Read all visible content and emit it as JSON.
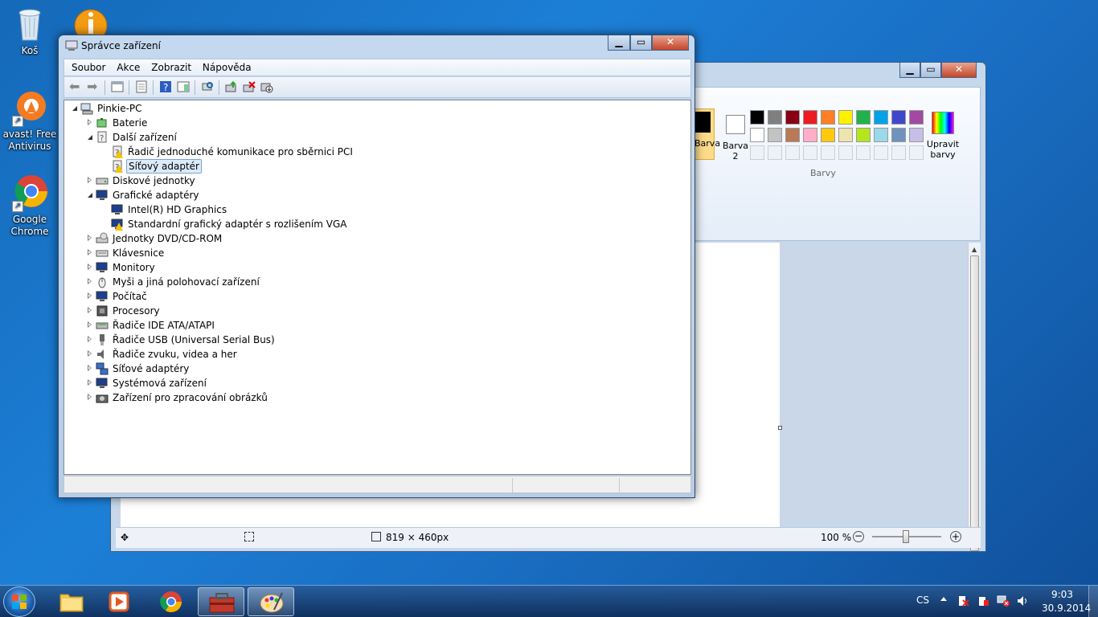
{
  "desktop": {
    "icons": [
      {
        "label": "Koš"
      },
      {
        "label": "avast! Free Antivirus"
      },
      {
        "label": "Google Chrome"
      }
    ]
  },
  "paint": {
    "ribbon": {
      "color1_label": "Barva",
      "color2_label": "Barva 2",
      "colors_group_label": "Barvy",
      "edit_colors_label": "Upravit barvy",
      "palette_row1": [
        "#000000",
        "#7f7f7f",
        "#880015",
        "#ed1c24",
        "#ff7f27",
        "#fff200",
        "#22b14c",
        "#00a2e8",
        "#3f48cc",
        "#a349a4"
      ],
      "palette_row2": [
        "#ffffff",
        "#c3c3c3",
        "#b97a57",
        "#ffaec9",
        "#ffc90e",
        "#efe4b0",
        "#b5e61d",
        "#99d9ea",
        "#7092be",
        "#c8bfe7"
      ]
    },
    "status": {
      "size": "819 × 460px",
      "zoom": "100 %"
    }
  },
  "devmgr": {
    "title": "Správce zařízení",
    "menu": [
      "Soubor",
      "Akce",
      "Zobrazit",
      "Nápověda"
    ],
    "tree": {
      "root": "Pinkie-PC",
      "nodes": [
        {
          "label": "Baterie"
        },
        {
          "label": "Další zařízení"
        },
        {
          "label": "Řadič jednoduché komunikace pro sběrnici PCI"
        },
        {
          "label": "Síťový adaptér"
        },
        {
          "label": "Diskové jednotky"
        },
        {
          "label": "Grafické adaptéry"
        },
        {
          "label": "Intel(R) HD Graphics"
        },
        {
          "label": "Standardní grafický adaptér s rozlišením VGA"
        },
        {
          "label": "Jednotky DVD/CD-ROM"
        },
        {
          "label": "Klávesnice"
        },
        {
          "label": "Monitory"
        },
        {
          "label": "Myši a jiná polohovací zařízení"
        },
        {
          "label": "Počítač"
        },
        {
          "label": "Procesory"
        },
        {
          "label": "Řadiče IDE ATA/ATAPI"
        },
        {
          "label": "Řadiče USB (Universal Serial Bus)"
        },
        {
          "label": "Řadiče zvuku, videa a her"
        },
        {
          "label": "Síťové adaptéry"
        },
        {
          "label": "Systémová zařízení"
        },
        {
          "label": "Zařízení pro zpracování obrázků"
        }
      ]
    }
  },
  "taskbar": {
    "lang": "CS",
    "time": "9:03",
    "date": "30.9.2014"
  }
}
